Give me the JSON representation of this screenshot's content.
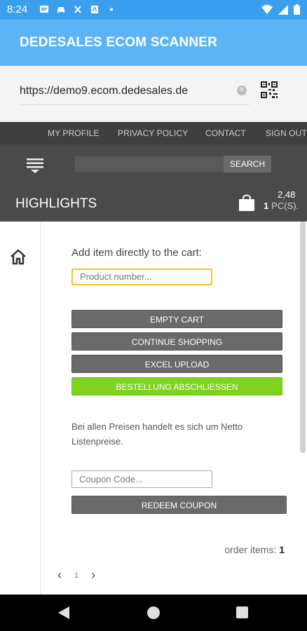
{
  "status_bar": {
    "time": "8:24",
    "left_icons": [
      "message-icon",
      "car-icon",
      "fan-icon",
      "notification-icon",
      "dot-icon"
    ],
    "right_icons": [
      "wifi-icon",
      "signal-icon",
      "battery-icon"
    ]
  },
  "app_bar": {
    "title": "DEDESALES ECOM SCANNER"
  },
  "url_bar": {
    "value": "https://demo9.ecom.dedesales.de",
    "clear_icon": "clear-icon",
    "scan_icon": "qr-code-icon"
  },
  "shop": {
    "top_nav": [
      "MY PROFILE",
      "PRIVACY POLICY",
      "CONTACT",
      "SIGN OUT"
    ],
    "search": {
      "placeholder": "",
      "button": "SEARCH"
    },
    "section_title": "HIGHLIGHTS",
    "cart": {
      "price": "2,48",
      "count": "1",
      "unit": "PC(S)."
    }
  },
  "cart_page": {
    "add_label": "Add item directly to the cart:",
    "product_placeholder": "Product number...",
    "buttons": {
      "empty": "EMPTY CART",
      "continue": "CONTINUE SHOPPING",
      "excel": "EXCEL UPLOAD",
      "checkout": "BESTELLUNG ABSCHLIESSEN",
      "redeem": "REDEEM COUPON"
    },
    "info": "Bei allen Preisen handelt es sich um Netto Listenpreise.",
    "coupon_placeholder": "Coupon Code...",
    "order_items_label": "order items:",
    "order_items_count": "1",
    "pagination": {
      "prev": "‹",
      "page": "1",
      "next": "›"
    }
  },
  "colors": {
    "status_bar": "#3b9ff0",
    "app_bar": "#5cb4f6",
    "shop_header": "#4a4a4a",
    "button_gray": "#6a6a6a",
    "button_green": "#7ed321",
    "input_focus": "#f5c518"
  }
}
